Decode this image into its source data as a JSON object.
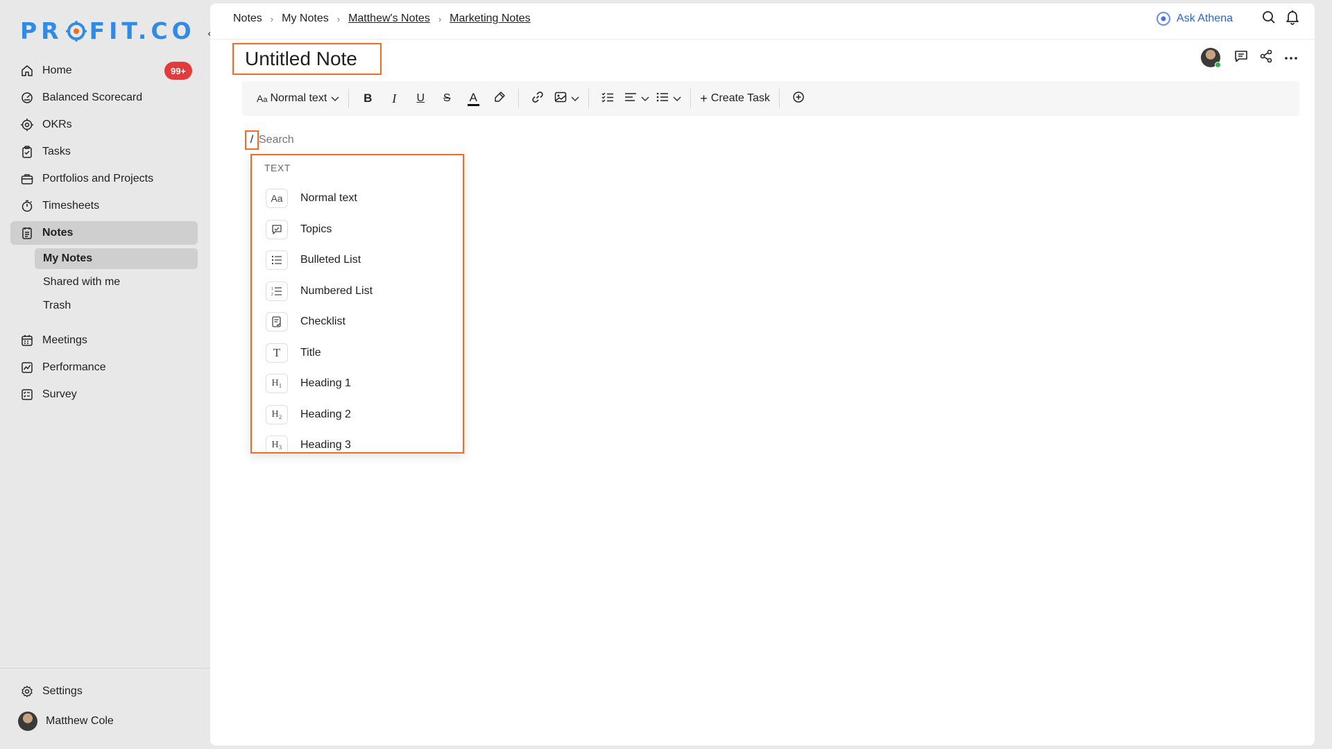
{
  "brand": {
    "logo_text_left": "PR",
    "logo_text_right": "FIT.CO",
    "color": "#2f8be6"
  },
  "sidebar": {
    "items": [
      {
        "label": "Home",
        "icon": "home-icon",
        "badge": "99+"
      },
      {
        "label": "Balanced Scorecard",
        "icon": "scorecard-icon"
      },
      {
        "label": "OKRs",
        "icon": "target-icon"
      },
      {
        "label": "Tasks",
        "icon": "clipboard-check-icon"
      },
      {
        "label": "Portfolios and Projects",
        "icon": "briefcase-icon"
      },
      {
        "label": "Timesheets",
        "icon": "stopwatch-icon"
      },
      {
        "label": "Notes",
        "icon": "notes-icon",
        "active": true
      }
    ],
    "notes_sub": [
      {
        "label": "My Notes",
        "active": true
      },
      {
        "label": "Shared with me"
      },
      {
        "label": "Trash"
      }
    ],
    "items_after": [
      {
        "label": "Meetings",
        "icon": "calendar-icon"
      },
      {
        "label": "Performance",
        "icon": "chart-line-icon"
      },
      {
        "label": "Survey",
        "icon": "survey-icon"
      }
    ],
    "settings_label": "Settings",
    "user_name": "Matthew Cole"
  },
  "header": {
    "breadcrumb": [
      "Notes",
      "My Notes",
      "Matthew's Notes",
      "Marketing Notes"
    ],
    "ask_athena": "Ask Athena"
  },
  "note": {
    "title": "Untitled Note"
  },
  "toolbar": {
    "text_style": "Normal text",
    "create_task": "Create Task"
  },
  "slash_menu": {
    "slash": "/",
    "search_placeholder": "Search",
    "section": "TEXT",
    "items": [
      {
        "label": "Normal text",
        "icon_glyph": "Aa",
        "icon": "text-aa-icon"
      },
      {
        "label": "Topics",
        "icon_glyph": "💬",
        "icon": "topics-icon"
      },
      {
        "label": "Bulleted List",
        "icon_glyph": "☰",
        "icon": "bulleted-list-icon"
      },
      {
        "label": "Numbered List",
        "icon_glyph": "1≡",
        "icon": "numbered-list-icon"
      },
      {
        "label": "Checklist",
        "icon_glyph": "☑",
        "icon": "checklist-icon"
      },
      {
        "label": "Title",
        "icon_glyph": "T",
        "icon": "title-icon"
      },
      {
        "label": "Heading 1",
        "icon_glyph": "H₁",
        "icon": "heading-1-icon"
      },
      {
        "label": "Heading 2",
        "icon_glyph": "H₂",
        "icon": "heading-2-icon"
      },
      {
        "label": "Heading 3",
        "icon_glyph": "H₃",
        "icon": "heading-3-icon"
      }
    ]
  },
  "colors": {
    "accent_highlight": "#f26b21",
    "badge": "#e23b3b",
    "athena": "#2a63c9"
  }
}
